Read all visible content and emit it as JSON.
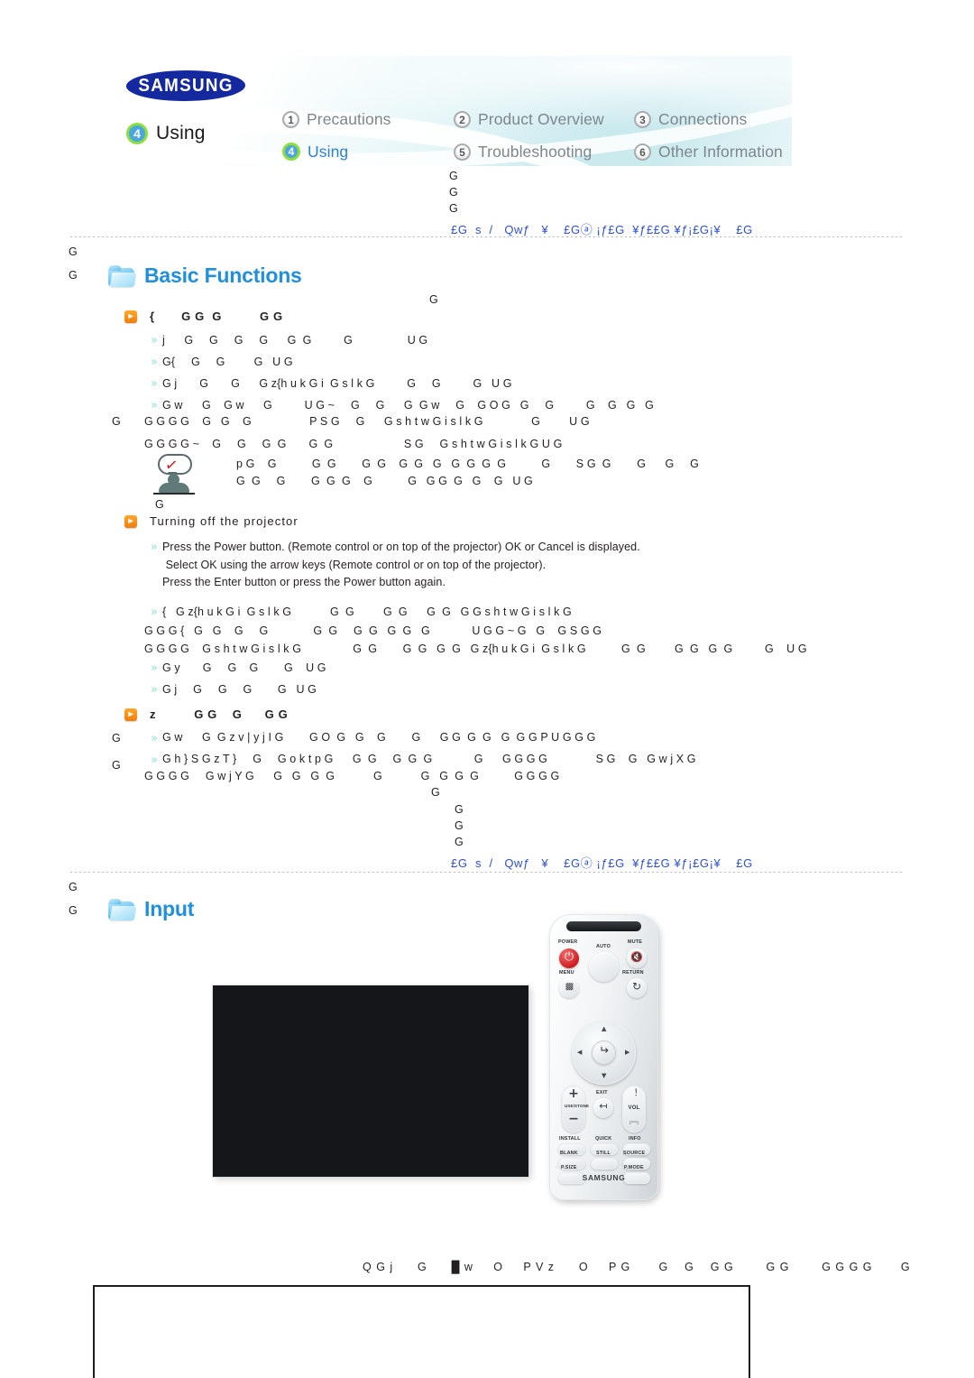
{
  "brand": {
    "logo": "SAMSUNG",
    "remote_brand": "SAMSUNG"
  },
  "header": {
    "current_chapter": {
      "number": "4",
      "label": "Using"
    },
    "nav": [
      {
        "number": "1",
        "label": "Precautions",
        "active": false
      },
      {
        "number": "2",
        "label": "Product Overview",
        "active": false
      },
      {
        "number": "3",
        "label": "Connections",
        "active": false
      },
      {
        "number": "4",
        "label": "Using",
        "active": true
      },
      {
        "number": "5",
        "label": "Troubleshooting",
        "active": false
      },
      {
        "number": "6",
        "label": "Other Information",
        "active": false
      }
    ]
  },
  "stray_glyphs": {
    "g1": "G",
    "g2": "G",
    "g3": "G",
    "left_a": "G",
    "left_b": "G",
    "left_c": "G",
    "left_d": "G",
    "left_e": "G",
    "left_f": "G",
    "left_g": "G",
    "left_h": "G",
    "left_i": "G",
    "left_j": "G",
    "left_k": "G",
    "mid_a": "G",
    "mid_b": "G",
    "mid_c": "G",
    "mid_d": "G",
    "mid_e": "G"
  },
  "blue_rule_text": "£G  s  /   Qwƒ   ¥    £Gⓐ ¡ƒ£G  ¥ƒ££G ¥ƒ¡£G¡¥    £G",
  "sections": [
    {
      "id": "basic-functions",
      "title": "Basic Functions",
      "icon": "folder-icon",
      "subsections": [
        {
          "id": "turning-on-the-projector",
          "heading": "{       G G  G          G G",
          "heading_garbled": true,
          "lines": [
            "j      G     G     G     G      G  G          G                 U G",
            "G{     G     G         G   U G",
            "G j       G       G      G z{h u k G i  G s l k G          G     G          G   U G",
            "G w      G    G w      G          U G ~     G     G      G  G w     G    G O G   G     G          G    G   G   G",
            "G G G G    G   G    G                  P S G     G      G s h t w G i s l k G               G         U G",
            "G G G G ~    G     G     G  G       G  G                      S G     G s h t w G i s l k G U G"
          ],
          "note": [
            "p G    G           G  G        G  G    G  G   G   G  G  G  G           G        S G  G        G      G     G",
            "G  G     G        G  G  G    G           G   G G  G   G    G   U G"
          ]
        },
        {
          "id": "turning-off-the-projector",
          "heading": "Turning off the projector",
          "heading_garbled": false,
          "lines": [
            "Press the Power button. (Remote control or on top of the projector) OK or Cancel is displayed.",
            " Select OK using the arrow keys (Remote control or on top of the projector).",
            "Press the Enter button or press the Power button again."
          ],
          "lines2": [
            "{   G z{h u k G i  G s l k G            G  G         G  G      G  G   G G s h t w G i s l k G",
            "G G G {   G   G    G     G              G  G     G  G   G  G   G             U G G ~ G   G    G S G G",
            "G G G G    G s h t w G i s l k G                G  G        G  G   G  G   G z{h u k G i  G s l k G           G  G         G  G   G  G          G    U G",
            "G y       G     G    G        G    U G",
            "G j     G     G     G        G   U G"
          ]
        },
        {
          "id": "source-selection",
          "heading": "z          G G    G      G G",
          "heading_garbled": true,
          "lines": [
            "G w      G  G z v | y j I G        G O  G   G    G        G      G G  G  G   G  G G P U G G G",
            "G h } S G z T }     G     G o k t p G      G  G     G  G  G             G      G G G G               S G    G   G w j X G",
            "G G G G     G w j Y G      G   G   G  G            G            G   G  G  G           G G G G"
          ]
        }
      ]
    },
    {
      "id": "input",
      "title": "Input",
      "icon": "folder-icon",
      "figure": {
        "screen": "projection-screen",
        "remote": "remote-control"
      },
      "caption": "Q G j      G      █ w     O     P V z      O     P G       G    G    G G        G G        G G G G       G"
    }
  ],
  "remote": {
    "ir_window": "ir-window",
    "buttons": [
      {
        "name": "power",
        "label": "POWER",
        "glyph": "power-symbol"
      },
      {
        "name": "auto",
        "label": "AUTO",
        "glyph": ""
      },
      {
        "name": "mute",
        "label": "MUTE",
        "glyph": "speaker-mute"
      },
      {
        "name": "menu",
        "label": "MENU",
        "glyph": "menu-bars"
      },
      {
        "name": "return",
        "label": "RETURN",
        "glyph": "return-arrow"
      },
      {
        "name": "dpad-up",
        "label": "",
        "glyph": "▲"
      },
      {
        "name": "dpad-down",
        "label": "",
        "glyph": "▼"
      },
      {
        "name": "dpad-left",
        "label": "",
        "glyph": "◀"
      },
      {
        "name": "dpad-right",
        "label": "",
        "glyph": "▶"
      },
      {
        "name": "enter",
        "label": "",
        "glyph": "enter-arrow"
      },
      {
        "name": "keystone",
        "label": "USE/STONE",
        "glyph": "plus-minus"
      },
      {
        "name": "exit",
        "label": "EXIT",
        "glyph": "exit-arrow"
      },
      {
        "name": "vol",
        "label": "VOL",
        "glyph": "chevrons"
      },
      {
        "name": "install",
        "label": "INSTALL",
        "glyph": ""
      },
      {
        "name": "quick",
        "label": "QUICK",
        "glyph": ""
      },
      {
        "name": "info",
        "label": "INFO",
        "glyph": ""
      },
      {
        "name": "blank",
        "label": "BLANK",
        "glyph": ""
      },
      {
        "name": "still",
        "label": "STILL",
        "glyph": ""
      },
      {
        "name": "source",
        "label": "SOURCE",
        "glyph": ""
      },
      {
        "name": "psize",
        "label": "P.SIZE",
        "glyph": ""
      },
      {
        "name": "pmode",
        "label": "P.MODE",
        "glyph": ""
      }
    ]
  },
  "colors": {
    "accent_blue": "#1f8fe0",
    "nav_active": "#2f7fd6",
    "nav_inactive": "#7d868c",
    "orange_bullet": "#f07d0c",
    "teal_chevron": "#8fe4d8",
    "samsung_blue": "#1428a0",
    "power_red": "#cf1b22",
    "rule_blue": "#2b4fd8",
    "screen_black": "#151619"
  }
}
